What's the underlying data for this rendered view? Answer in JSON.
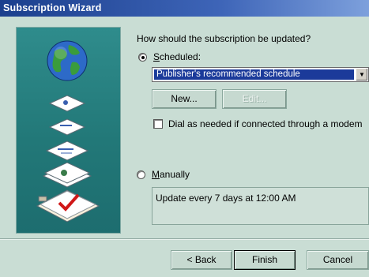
{
  "window": {
    "title": "Subscription Wizard"
  },
  "question": "How should the subscription be updated?",
  "scheduled": {
    "label": "Scheduled:",
    "selected": true,
    "schedule_value": "Publisher's recommended schedule",
    "new_button": "New...",
    "edit_button": "Edit...",
    "dial_label": "Dial as needed if connected through a modem",
    "dial_checked": false
  },
  "manually": {
    "label": "Manually",
    "selected": false,
    "info_text": "Update every 7 days at 12:00 AM"
  },
  "footer": {
    "back_button": "< Back",
    "finish_button": "Finish",
    "cancel_button": "Cancel"
  }
}
